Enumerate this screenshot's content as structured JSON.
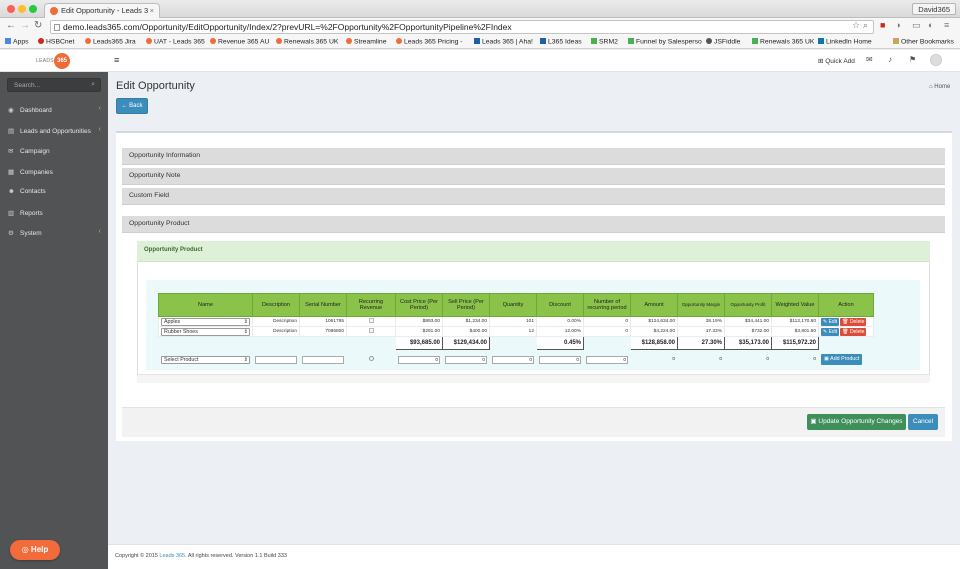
{
  "browser": {
    "tab_title": "Edit Opportunity - Leads 3",
    "tab_close": "×",
    "user_button": "David365",
    "url": "demo.leads365.com/Opportunity/EditOpportunity/Index/2?prevURL=%2FOpportunity%2FOpportunityPipeline%2FIndex",
    "bookmarks": [
      {
        "label": "Apps",
        "color": "#4a8ae0"
      },
      {
        "label": "HSBCnet",
        "color": "#d1271b"
      },
      {
        "label": "Leads365 Jira",
        "color": "#f26b3a"
      },
      {
        "label": "UAT - Leads 365",
        "color": "#f26b3a"
      },
      {
        "label": "Revenue 365 AU",
        "color": "#f26b3a"
      },
      {
        "label": "Renewals 365 UK",
        "color": "#f26b3a"
      },
      {
        "label": "Streamline",
        "color": "#f26b3a"
      },
      {
        "label": "Leads 365 Pricing -",
        "color": "#f26b3a"
      },
      {
        "label": "Leads 365 | Aha!",
        "color": "#1f5fa8"
      },
      {
        "label": "L365 Ideas",
        "color": "#1f5fa8"
      },
      {
        "label": "SRM2",
        "color": "#4caf50"
      },
      {
        "label": "Funnel by Salesperso",
        "color": "#4caf50"
      },
      {
        "label": "JSFiddle",
        "color": "#555555"
      },
      {
        "label": "Renewals 365 UK",
        "color": "#4caf50"
      },
      {
        "label": "LinkedIn Home",
        "color": "#0e76a8"
      },
      {
        "label": "Other Bookmarks",
        "color": "#c9a65a"
      }
    ]
  },
  "header": {
    "logo_text": "LEADS",
    "logo_badge": "365",
    "menu_toggle": "≡",
    "quick_add": "⊞ Quick Add"
  },
  "sidebar": {
    "search_placeholder": "Search...",
    "items": [
      {
        "label": "Dashboard",
        "icon": "◉",
        "has_children": true
      },
      {
        "label": "Leads and Opportunities",
        "icon": "▤",
        "has_children": true
      },
      {
        "label": "Campaign",
        "icon": "✉",
        "has_children": false
      },
      {
        "label": "Companies",
        "icon": "▦",
        "has_children": false
      },
      {
        "label": "Contacts",
        "icon": "☻",
        "has_children": false
      },
      {
        "label": "Reports",
        "icon": "▥",
        "has_children": false
      },
      {
        "label": "System",
        "icon": "⚙",
        "has_children": true
      }
    ],
    "help_label": "Help"
  },
  "page": {
    "title": "Edit Opportunity",
    "breadcrumb": "Home",
    "back_label": "Back",
    "sections": [
      "Opportunity Information",
      "Opportunity Note",
      "Custom Field",
      "Opportunity Product"
    ],
    "product_panel_title": "Opportunity Product"
  },
  "table": {
    "headers": [
      "Name",
      "Description",
      "Serial Number",
      "Recurring Revenue",
      "Cost Price (Per Period)",
      "Sell Price (Per Period)",
      "Quantity",
      "Discount",
      "Number of recurring period",
      "Amount",
      "Opportunity Margin",
      "Opportunity Profit",
      "Weighted Value",
      "Action"
    ],
    "rows": [
      {
        "name": "Apples",
        "description": "Description",
        "serial": "1061795",
        "cost": "$893.00",
        "sell": "$1,234.00",
        "qty": "101",
        "discount": "0.00%",
        "periods": "0",
        "amount": "$124,634.00",
        "margin": "38.19%",
        "profit": "$34,441.00",
        "weighted": "$112,170.60"
      },
      {
        "name": "Rubber Shoes",
        "description": "Description",
        "serial": "7086800",
        "cost": "$291.00",
        "sell": "$400.00",
        "qty": "12",
        "discount": "12.00%",
        "periods": "0",
        "amount": "$4,224.00",
        "margin": "17.33%",
        "profit": "$732.00",
        "weighted": "$3,801.60"
      }
    ],
    "totals": {
      "cost": "$93,685.00",
      "sell": "$129,434.00",
      "discount": "0.45%",
      "amount": "$128,858.00",
      "margin": "27.30%",
      "profit": "$35,173.00",
      "weighted": "$115,972.20"
    },
    "new_row": {
      "select_placeholder": "Select Product",
      "cost": "0",
      "sell": "0",
      "qty": "0",
      "discount": "0",
      "periods": "0",
      "amount": "0",
      "margin": "0",
      "profit": "0",
      "weighted": "0"
    },
    "edit_label": "✎ Edit",
    "delete_label": "🗑 Delete",
    "add_product_label": "▣ Add Product"
  },
  "actions": {
    "update_label": "▣ Update Opportunity Changes",
    "cancel_label": "Cancel"
  },
  "footer": {
    "prefix": "Copyright © 2015",
    "link": "Leads 365",
    "suffix": ". All rights reserved. Version 1.1 Build 333"
  }
}
